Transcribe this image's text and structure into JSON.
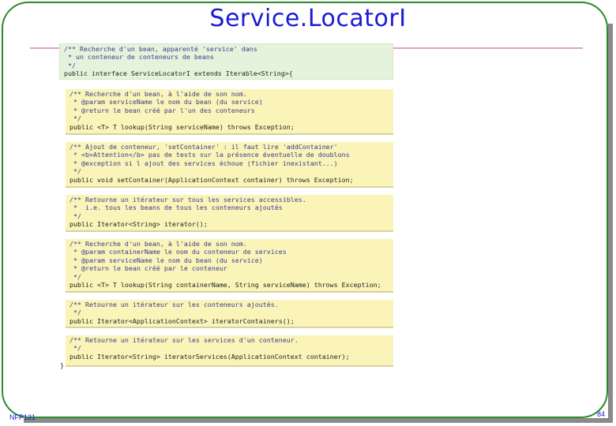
{
  "slide": {
    "title": "Service.LocatorI",
    "footer_left": "NFP121",
    "page_number": "84"
  },
  "code": {
    "header": [
      "/** Recherche d'un bean, apparenté 'service' dans",
      " * un conteneur de conteneurs de beans",
      " */",
      "public interface ServiceLocatorI extends Iterable<String>{"
    ],
    "blocks": [
      [
        "/** Recherche d'un bean, à l'aide de son nom.",
        " * @param serviceName le nom du bean (du service)",
        " * @return le bean créé par l'un des conteneurs",
        " */",
        "public <T> T lookup(String serviceName) throws Exception;"
      ],
      [
        "/** Ajout de conteneur, 'setContainer' : il faut lire 'addContainer'",
        " * <b>Attention</b> pas de tests sur la présence éventuelle de doublons",
        " * @exception si l ajout des services échoue (fichier inexistant...)",
        " */",
        "public void setContainer(ApplicationContext container) throws Exception;"
      ],
      [
        "/** Retourne un itérateur sur tous les services accessibles.",
        " *  i.e. tous les beans de tous les conteneurs ajoutés",
        " */",
        "public Iterator<String> iterator();"
      ],
      [
        "/** Recherche d'un bean, à l'aide de son nom.",
        " * @param containerName le nom du conteneur de services",
        " * @param serviceName le nom du bean (du service)",
        " * @return le bean créé par le conteneur",
        " */",
        "public <T> T lookup(String containerName, String serviceName) throws Exception;"
      ],
      [
        "/** Retourne un itérateur sur les conteneurs ajoutés.",
        " */",
        "public Iterator<ApplicationContext> iteratorContainers();"
      ],
      [
        "/** Retourne un itérateur sur les services d'un conteneur.",
        " */",
        "public Iterator<String> iteratorServices(ApplicationContext container);"
      ]
    ],
    "closing": "}"
  }
}
